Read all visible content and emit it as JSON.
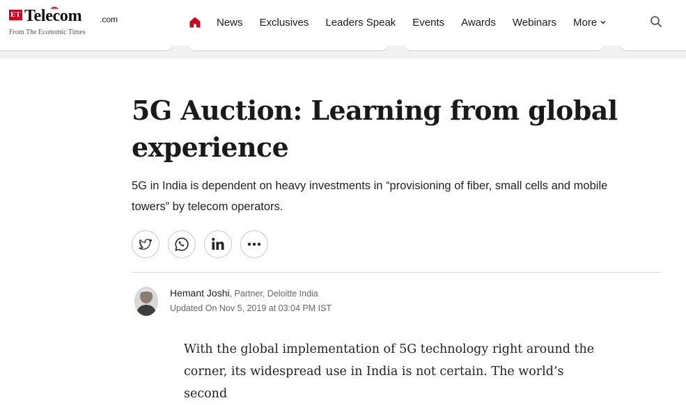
{
  "brand": {
    "logo_et": "ET",
    "logo_word": "Telecom",
    "logo_suffix": ".com",
    "logo_tagline": "From The Economic Times"
  },
  "nav": {
    "items": [
      "News",
      "Exclusives",
      "Leaders Speak",
      "Events",
      "Awards",
      "Webinars"
    ],
    "more_label": "More"
  },
  "article": {
    "title": "5G Auction: Learning from global experience",
    "summary": "5G in India is dependent on heavy investments in “provisioning of fiber, small cells and mobile towers” by telecom operators.",
    "author_name": "Hemant Joshi",
    "author_role": ", Partner, Deloitte India",
    "updated": "Updated On Nov 5, 2019 at 03:04 PM IST",
    "body_start": "With the global implementation of 5G technology right around the corner, its widespread use in India is not certain. The world’s second"
  },
  "share": {
    "icons": [
      "twitter-icon",
      "whatsapp-icon",
      "linkedin-icon",
      "more-dots-icon"
    ]
  },
  "colors": {
    "brand_red": "#d0021b",
    "text": "#1a1a1a",
    "muted": "#666666"
  }
}
